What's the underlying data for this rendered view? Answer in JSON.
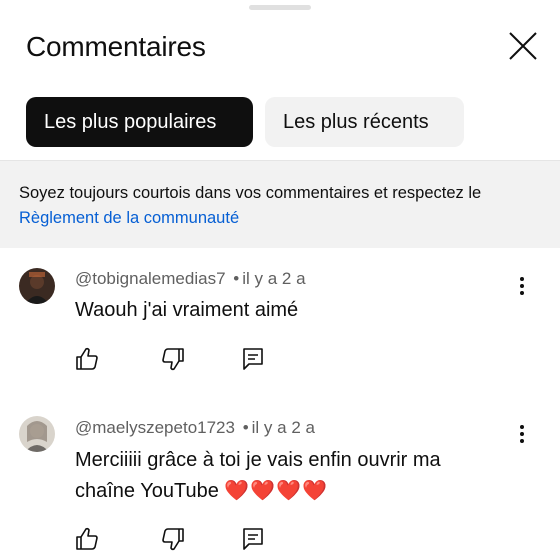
{
  "panel": {
    "title": "Commentaires"
  },
  "tabs": [
    {
      "label": "Les plus populaires",
      "active": true
    },
    {
      "label": "Les plus récents",
      "active": false
    }
  ],
  "notice": {
    "text": "Soyez toujours courtois dans vos commentaires et respectez le",
    "link": "Règlement de la communauté"
  },
  "comments": [
    {
      "author": "@tobignalemedias7",
      "separator": "•",
      "time": "il y a 2 a",
      "text": "Waouh j'ai vraiment aimé"
    },
    {
      "author": "@maelyszepeto1723",
      "separator": "•",
      "time": "il y a 2 a",
      "text_line1": "Merciiiii grâce à toi je vais enfin ouvrir ma",
      "text_line2": "chaîne YouTube",
      "emoji": "❤️❤️❤️❤️"
    }
  ],
  "colors": {
    "link": "#065fd4",
    "chip_active_bg": "#0f0f0f",
    "chip_inactive_bg": "#f2f2f2",
    "notice_bg": "#f2f2f2",
    "meta_text": "#606060"
  },
  "icons": [
    "close-icon",
    "more-vert-icon",
    "thumb-up-icon",
    "thumb-down-icon",
    "reply-icon"
  ]
}
